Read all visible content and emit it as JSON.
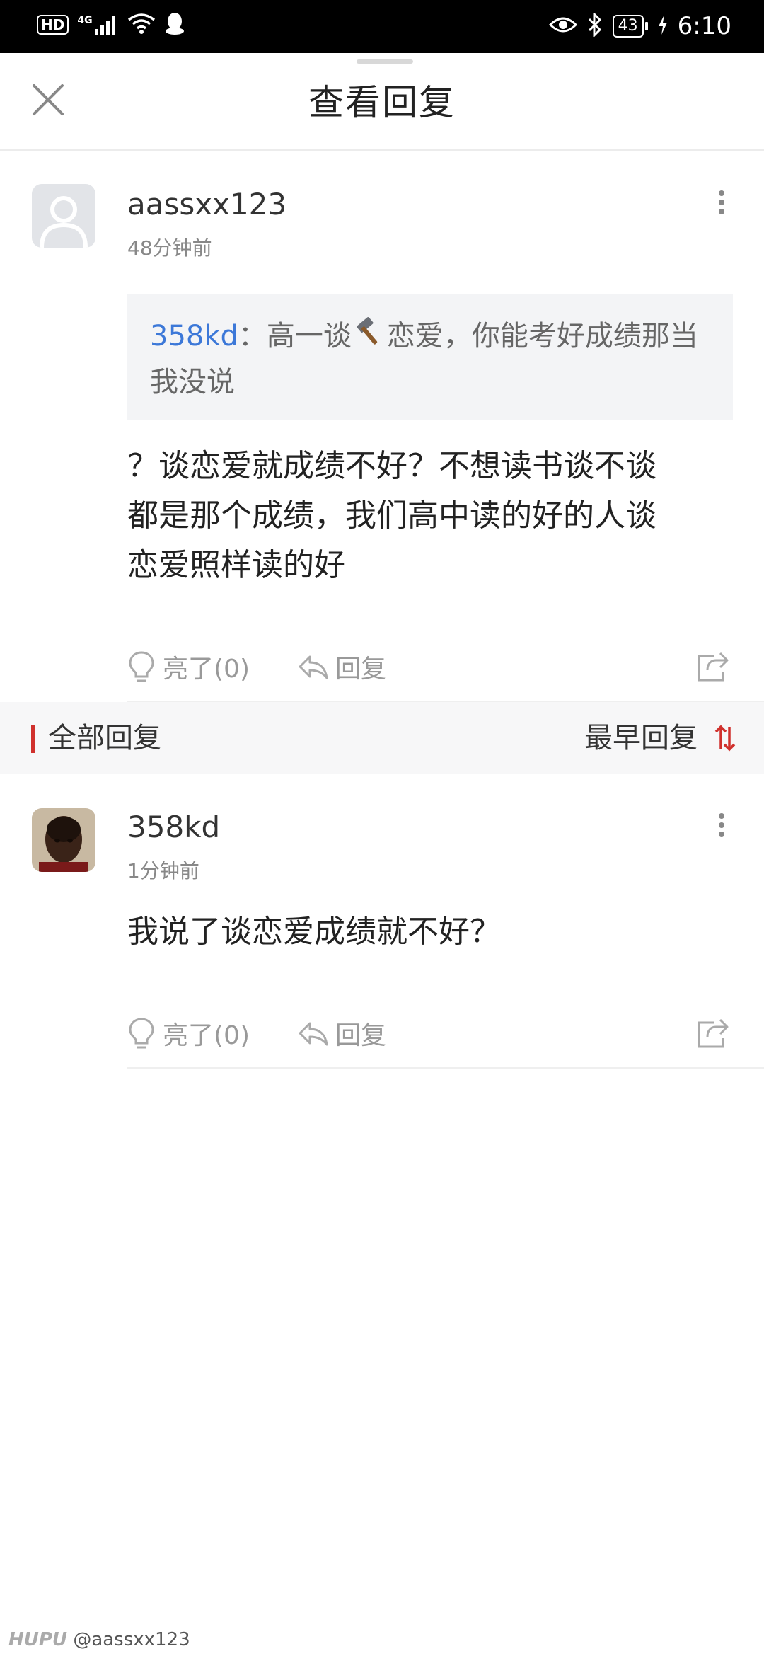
{
  "status_bar": {
    "left_badge": "HD",
    "network": "4G",
    "battery": "43",
    "time": "6:10"
  },
  "header": {
    "title": "查看回复"
  },
  "main_comment": {
    "username": "aassxx123",
    "time": "48分钟前",
    "quote_user": "358kd",
    "quote_sep": "：",
    "quote_text_a": "高一谈",
    "quote_text_b": "恋爱，你能考好成绩那当",
    "quote_text_c": "我没说",
    "body_lines": [
      "？谈恋爱就成绩不好？不想读书谈不谈",
      "都是那个成绩，我们高中读的好的人谈",
      "恋爱照样读的好"
    ],
    "like_label": "亮了(0)",
    "reply_label": "回复"
  },
  "section": {
    "title": "全部回复",
    "sort_label": "最早回复"
  },
  "replies": [
    {
      "username": "358kd",
      "time": "1分钟前",
      "body": "我说了谈恋爱成绩就不好？",
      "like_label": "亮了(0)",
      "reply_label": "回复"
    }
  ],
  "watermark": {
    "brand": "HUPU",
    "handle": "@aassxx123"
  },
  "colors": {
    "accent_red": "#d0312d",
    "link_blue": "#3c78d8",
    "quote_bg": "#f3f4f6"
  },
  "icons": [
    "close-icon",
    "more-vertical-icon",
    "lightbulb-icon",
    "reply-arrow-icon",
    "share-icon",
    "sort-arrows-icon",
    "hammer-emoji-icon"
  ]
}
